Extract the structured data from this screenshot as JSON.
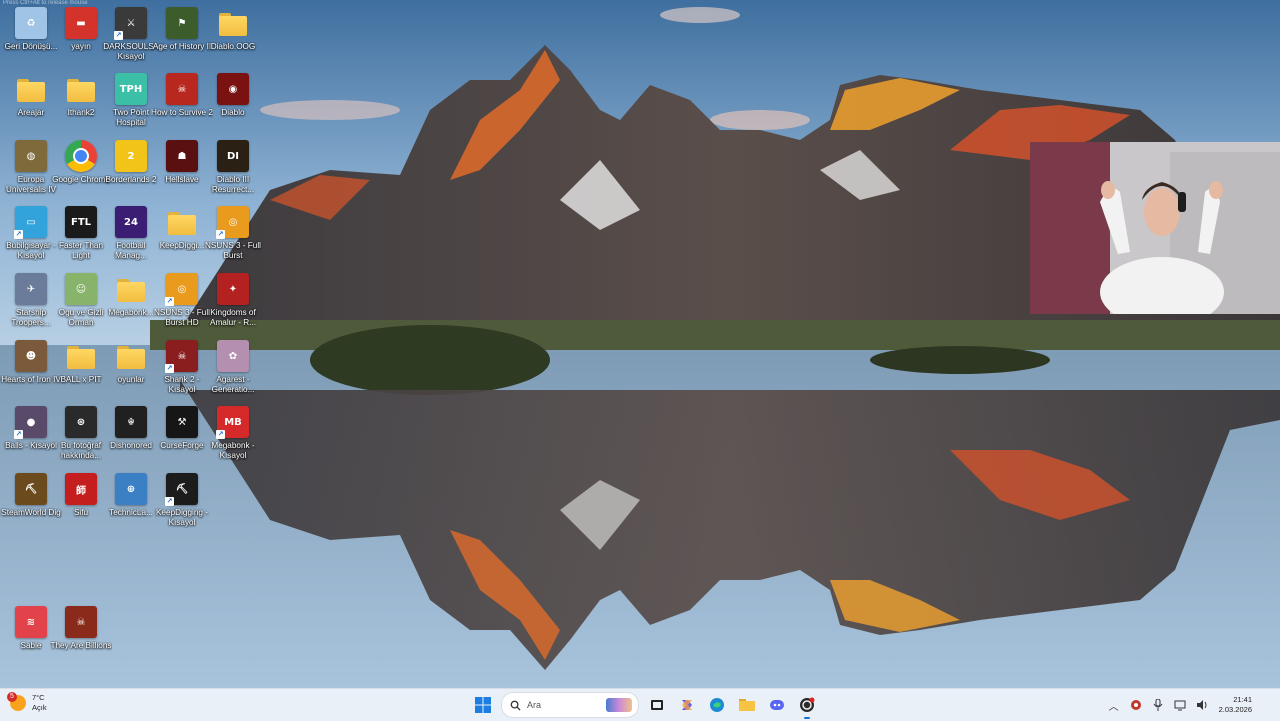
{
  "top_note": "Press Ctrl+Alt to release mouse",
  "desktop": {
    "icons": [
      {
        "label": "Geri Dönüşü...",
        "kind": "recycle",
        "color": "#9fc4e6",
        "glyph": "♻",
        "shortcut": false
      },
      {
        "label": "yayın",
        "kind": "app",
        "color": "#d4332b",
        "glyph": "▬",
        "shortcut": false
      },
      {
        "label": "DARKSOULS - Kısayol",
        "kind": "app",
        "color": "#3a3a3a",
        "glyph": "⚔",
        "shortcut": true
      },
      {
        "label": "Age of History II",
        "kind": "app",
        "color": "#3c5c2b",
        "glyph": "⚑",
        "shortcut": false
      },
      {
        "label": "Diablo.OOG",
        "kind": "folder",
        "color": "#f2bd3f",
        "glyph": "",
        "shortcut": false
      },
      {
        "label": "Areajar",
        "kind": "folder",
        "color": "#f2bd3f",
        "glyph": "",
        "shortcut": false
      },
      {
        "label": "Ithank2",
        "kind": "folder",
        "color": "#f2bd3f",
        "glyph": "",
        "shortcut": false
      },
      {
        "label": "Two Point Hospital",
        "kind": "app",
        "color": "#3bbfa6",
        "glyph": "TPH",
        "shortcut": false
      },
      {
        "label": "How to Survive 2",
        "kind": "app",
        "color": "#b8281f",
        "glyph": "☠",
        "shortcut": false
      },
      {
        "label": "Diablo",
        "kind": "app",
        "color": "#7a1212",
        "glyph": "◉",
        "shortcut": false
      },
      {
        "label": "Europa Universalis IV",
        "kind": "app",
        "color": "#7e6a3b",
        "glyph": "◍",
        "shortcut": false
      },
      {
        "label": "Google Chrome",
        "kind": "chrome",
        "color": "#ffffff",
        "glyph": "",
        "shortcut": false
      },
      {
        "label": "Borderlands 2",
        "kind": "app",
        "color": "#f2c318",
        "glyph": "2",
        "shortcut": false
      },
      {
        "label": "Hellslave",
        "kind": "app",
        "color": "#5a1010",
        "glyph": "☗",
        "shortcut": false
      },
      {
        "label": "Diablo III Resurrect...",
        "kind": "app",
        "color": "#2b2014",
        "glyph": "DI",
        "shortcut": false
      },
      {
        "label": "Bubilgisayar - Kısayol",
        "kind": "app",
        "color": "#33a3dc",
        "glyph": "▭",
        "shortcut": true
      },
      {
        "label": "Faster Than Light",
        "kind": "app",
        "color": "#1a1a1a",
        "glyph": "FTL",
        "shortcut": false
      },
      {
        "label": "Football Manag...",
        "kind": "app",
        "color": "#3b1d74",
        "glyph": "24",
        "shortcut": false
      },
      {
        "label": "KeepDiggi...",
        "kind": "folder",
        "color": "#f2bd3f",
        "glyph": "",
        "shortcut": false
      },
      {
        "label": "NSUNS 3 - Full Burst",
        "kind": "app",
        "color": "#e89b1d",
        "glyph": "◎",
        "shortcut": true
      },
      {
        "label": "Starship Troopers...",
        "kind": "app",
        "color": "#6a7c9a",
        "glyph": "✈",
        "shortcut": false
      },
      {
        "label": "Ogu ve Gizli Orman",
        "kind": "app",
        "color": "#88b36a",
        "glyph": "☺",
        "shortcut": false
      },
      {
        "label": "Megabonk...",
        "kind": "folder",
        "color": "#f2bd3f",
        "glyph": "",
        "shortcut": false
      },
      {
        "label": "NSUNS 3 - Full Burst HD",
        "kind": "app",
        "color": "#e89b1d",
        "glyph": "◎",
        "shortcut": true
      },
      {
        "label": "Kingdoms of Amalur - R...",
        "kind": "app",
        "color": "#b32121",
        "glyph": "✦",
        "shortcut": false
      },
      {
        "label": "Hearts of Iron IV",
        "kind": "app",
        "color": "#7a5a3a",
        "glyph": "☻",
        "shortcut": false
      },
      {
        "label": "BALL x PIT",
        "kind": "folder",
        "color": "#f2bd3f",
        "glyph": "",
        "shortcut": false
      },
      {
        "label": "oyunlar",
        "kind": "folder",
        "color": "#f2bd3f",
        "glyph": "",
        "shortcut": false
      },
      {
        "label": "Shank 2 - Kısayol",
        "kind": "app",
        "color": "#8a1e1e",
        "glyph": "☠",
        "shortcut": true
      },
      {
        "label": "Agarest - Generatio...",
        "kind": "app",
        "color": "#b48fb0",
        "glyph": "✿",
        "shortcut": false
      },
      {
        "label": "Balls - Kısayol",
        "kind": "app",
        "color": "#5a4a6a",
        "glyph": "●",
        "shortcut": true
      },
      {
        "label": "Bu fotoğraf hakkında...",
        "kind": "app",
        "color": "#2a2a2a",
        "glyph": "⊛",
        "shortcut": false
      },
      {
        "label": "Dishonored",
        "kind": "app",
        "color": "#202020",
        "glyph": "☬",
        "shortcut": false
      },
      {
        "label": "CurseForge",
        "kind": "app",
        "color": "#161616",
        "glyph": "⚒",
        "shortcut": false
      },
      {
        "label": "Megabonk - Kısayol",
        "kind": "app",
        "color": "#d62a2a",
        "glyph": "MB",
        "shortcut": true
      },
      {
        "label": "SteamWorld Dig",
        "kind": "app",
        "color": "#6b4a1e",
        "glyph": "⛏",
        "shortcut": false
      },
      {
        "label": "Sifu",
        "kind": "app",
        "color": "#c41e1e",
        "glyph": "師",
        "shortcut": false
      },
      {
        "label": "TechnicLa...",
        "kind": "app",
        "color": "#3b7fc4",
        "glyph": "⊕",
        "shortcut": false
      },
      {
        "label": "KeepDigging - Kısayol",
        "kind": "app",
        "color": "#1c1c1c",
        "glyph": "⛏",
        "shortcut": true
      },
      {
        "label": "Sable",
        "kind": "app",
        "color": "#e2434b",
        "glyph": "≋",
        "shortcut": false
      },
      {
        "label": "They Are Billions",
        "kind": "app",
        "color": "#8a2a1a",
        "glyph": "☠",
        "shortcut": false
      }
    ]
  },
  "taskbar": {
    "weather": {
      "temp": "7°C",
      "condition": "Açık",
      "badge": "5"
    },
    "search_placeholder": "Ara",
    "clock": {
      "time": "21:41",
      "date": "2.03.2026"
    }
  }
}
